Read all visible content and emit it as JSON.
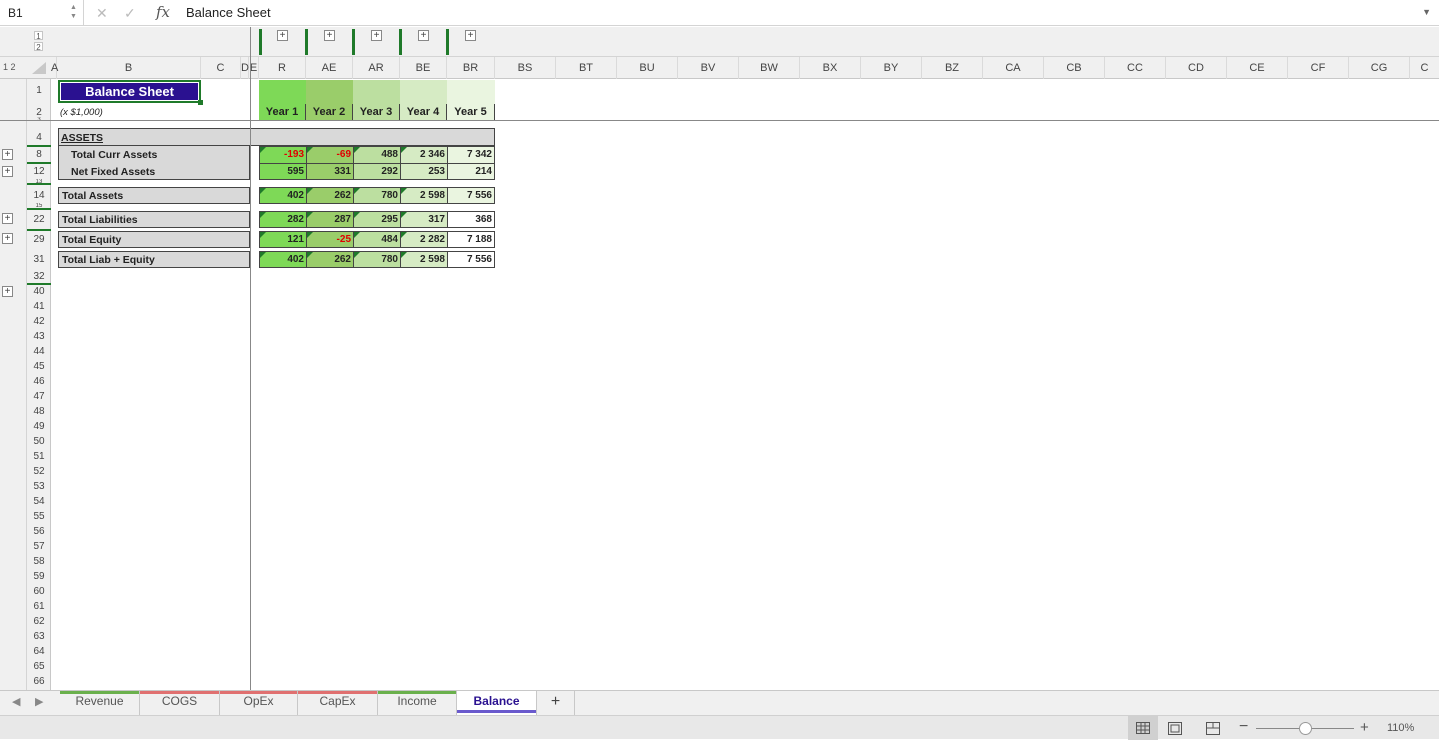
{
  "formula_bar": {
    "cell_ref": "B1",
    "formula": "Balance Sheet",
    "fx_label": "fx"
  },
  "outline": {
    "row_levels": [
      "1",
      "2"
    ],
    "col_levels": [
      "1",
      "2"
    ]
  },
  "columns": [
    "A",
    "B",
    "C",
    "D",
    "E",
    "R",
    "AE",
    "AR",
    "BE",
    "BR",
    "BS",
    "BT",
    "BU",
    "BV",
    "BW",
    "BX",
    "BY",
    "BZ",
    "CA",
    "CB",
    "CC",
    "CD",
    "CE",
    "CF",
    "CG",
    "C"
  ],
  "rows": [
    "1",
    "2",
    "3",
    "4",
    "8",
    "12",
    "13",
    "14",
    "15",
    "22",
    "29",
    "31",
    "32",
    "40",
    "41",
    "42",
    "43",
    "44",
    "45",
    "46",
    "47",
    "48",
    "49",
    "50",
    "51",
    "52",
    "53",
    "54",
    "55",
    "56",
    "57",
    "58",
    "59",
    "60",
    "61",
    "62",
    "63",
    "64",
    "65",
    "66"
  ],
  "sheet": {
    "title": "Balance Sheet",
    "unit_note": "(x $1,000)",
    "years": [
      "Year 1",
      "Year 2",
      "Year 3",
      "Year 4",
      "Year 5"
    ],
    "assets_header": "ASSETS",
    "rows": [
      {
        "label": "Total Curr Assets",
        "values": [
          "-193",
          "-69",
          "488",
          "2 346",
          "7 342"
        ]
      },
      {
        "label": "Net Fixed Assets",
        "values": [
          "595",
          "331",
          "292",
          "253",
          "214"
        ]
      },
      {
        "label": "Total Assets",
        "values": [
          "402",
          "262",
          "780",
          "2 598",
          "7 556"
        ]
      },
      {
        "label": "Total Liabilities",
        "values": [
          "282",
          "287",
          "295",
          "317",
          "368"
        ]
      },
      {
        "label": "Total Equity",
        "values": [
          "121",
          "-25",
          "484",
          "2 282",
          "7 188"
        ]
      },
      {
        "label": "Total Liab + Equity",
        "values": [
          "402",
          "262",
          "780",
          "2 598",
          "7 556"
        ]
      }
    ]
  },
  "tabs": [
    {
      "label": "Revenue",
      "color": "#6ab04c"
    },
    {
      "label": "COGS",
      "color": "#e07070"
    },
    {
      "label": "OpEx",
      "color": "#e07070"
    },
    {
      "label": "CapEx",
      "color": "#e07070"
    },
    {
      "label": "Income",
      "color": "#6ab04c"
    },
    {
      "label": "Balance",
      "color": "#6a5acd"
    }
  ],
  "add_sheet_label": "+",
  "status": {
    "zoom": "110%"
  },
  "colors": {
    "title_bg": "#2a1190",
    "year1": "#7ed957",
    "year2": "#9acd6a",
    "year3": "#bcdfa0",
    "year4": "#d6ebc4",
    "year5": "#eaf5e0"
  }
}
